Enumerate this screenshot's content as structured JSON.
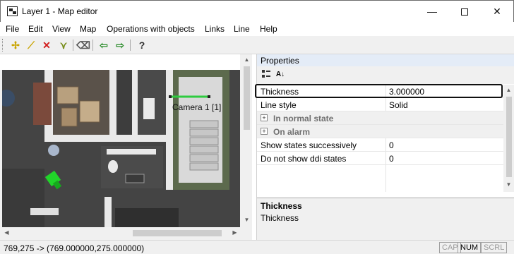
{
  "window": {
    "title": "Layer 1 - Map editor"
  },
  "menu": [
    "File",
    "Edit",
    "View",
    "Map",
    "Operations with objects",
    "Links",
    "Line",
    "Help"
  ],
  "toolbar": {
    "buttons": [
      {
        "icon": "add-point-icon",
        "glyph": "✢",
        "color": "#c9a400"
      },
      {
        "icon": "draw-line-icon",
        "glyph": "⟋",
        "color": "#c9a400"
      },
      {
        "icon": "delete-icon",
        "glyph": "✕",
        "color": "#d21f1f"
      },
      {
        "icon": "vertex-edit-icon",
        "glyph": "⋎",
        "color": "#7a8f1e"
      },
      {
        "icon": "eraser-icon",
        "glyph": "⌫",
        "color": "#555555"
      },
      {
        "icon": "undo-icon",
        "glyph": "⇦",
        "color": "#2f8f2f"
      },
      {
        "icon": "redo-icon",
        "glyph": "⇨",
        "color": "#2f8f2f"
      },
      {
        "icon": "help-icon",
        "glyph": "?",
        "color": "#333333"
      }
    ]
  },
  "map": {
    "camera_label": "Camera 1 [1]",
    "line_color": "#2ecc40"
  },
  "properties": {
    "title": "Properties",
    "rows": [
      {
        "name": "Thickness",
        "value": "3.000000",
        "kind": "prop"
      },
      {
        "name": "Line style",
        "value": "Solid",
        "kind": "prop"
      },
      {
        "name": "In normal state",
        "value": "",
        "kind": "group"
      },
      {
        "name": "On alarm",
        "value": "",
        "kind": "group"
      },
      {
        "name": "Show states successively",
        "value": "0",
        "kind": "prop"
      },
      {
        "name": "Do not show ddi states",
        "value": "0",
        "kind": "prop"
      }
    ],
    "description": {
      "title": "Thickness",
      "text": "Thickness"
    }
  },
  "status": {
    "coords": "769,275 -> (769.000000,275.000000)",
    "indicators": [
      {
        "label": "CAP",
        "active": false
      },
      {
        "label": "NUM",
        "active": true
      },
      {
        "label": "SCRL",
        "active": false
      }
    ]
  }
}
